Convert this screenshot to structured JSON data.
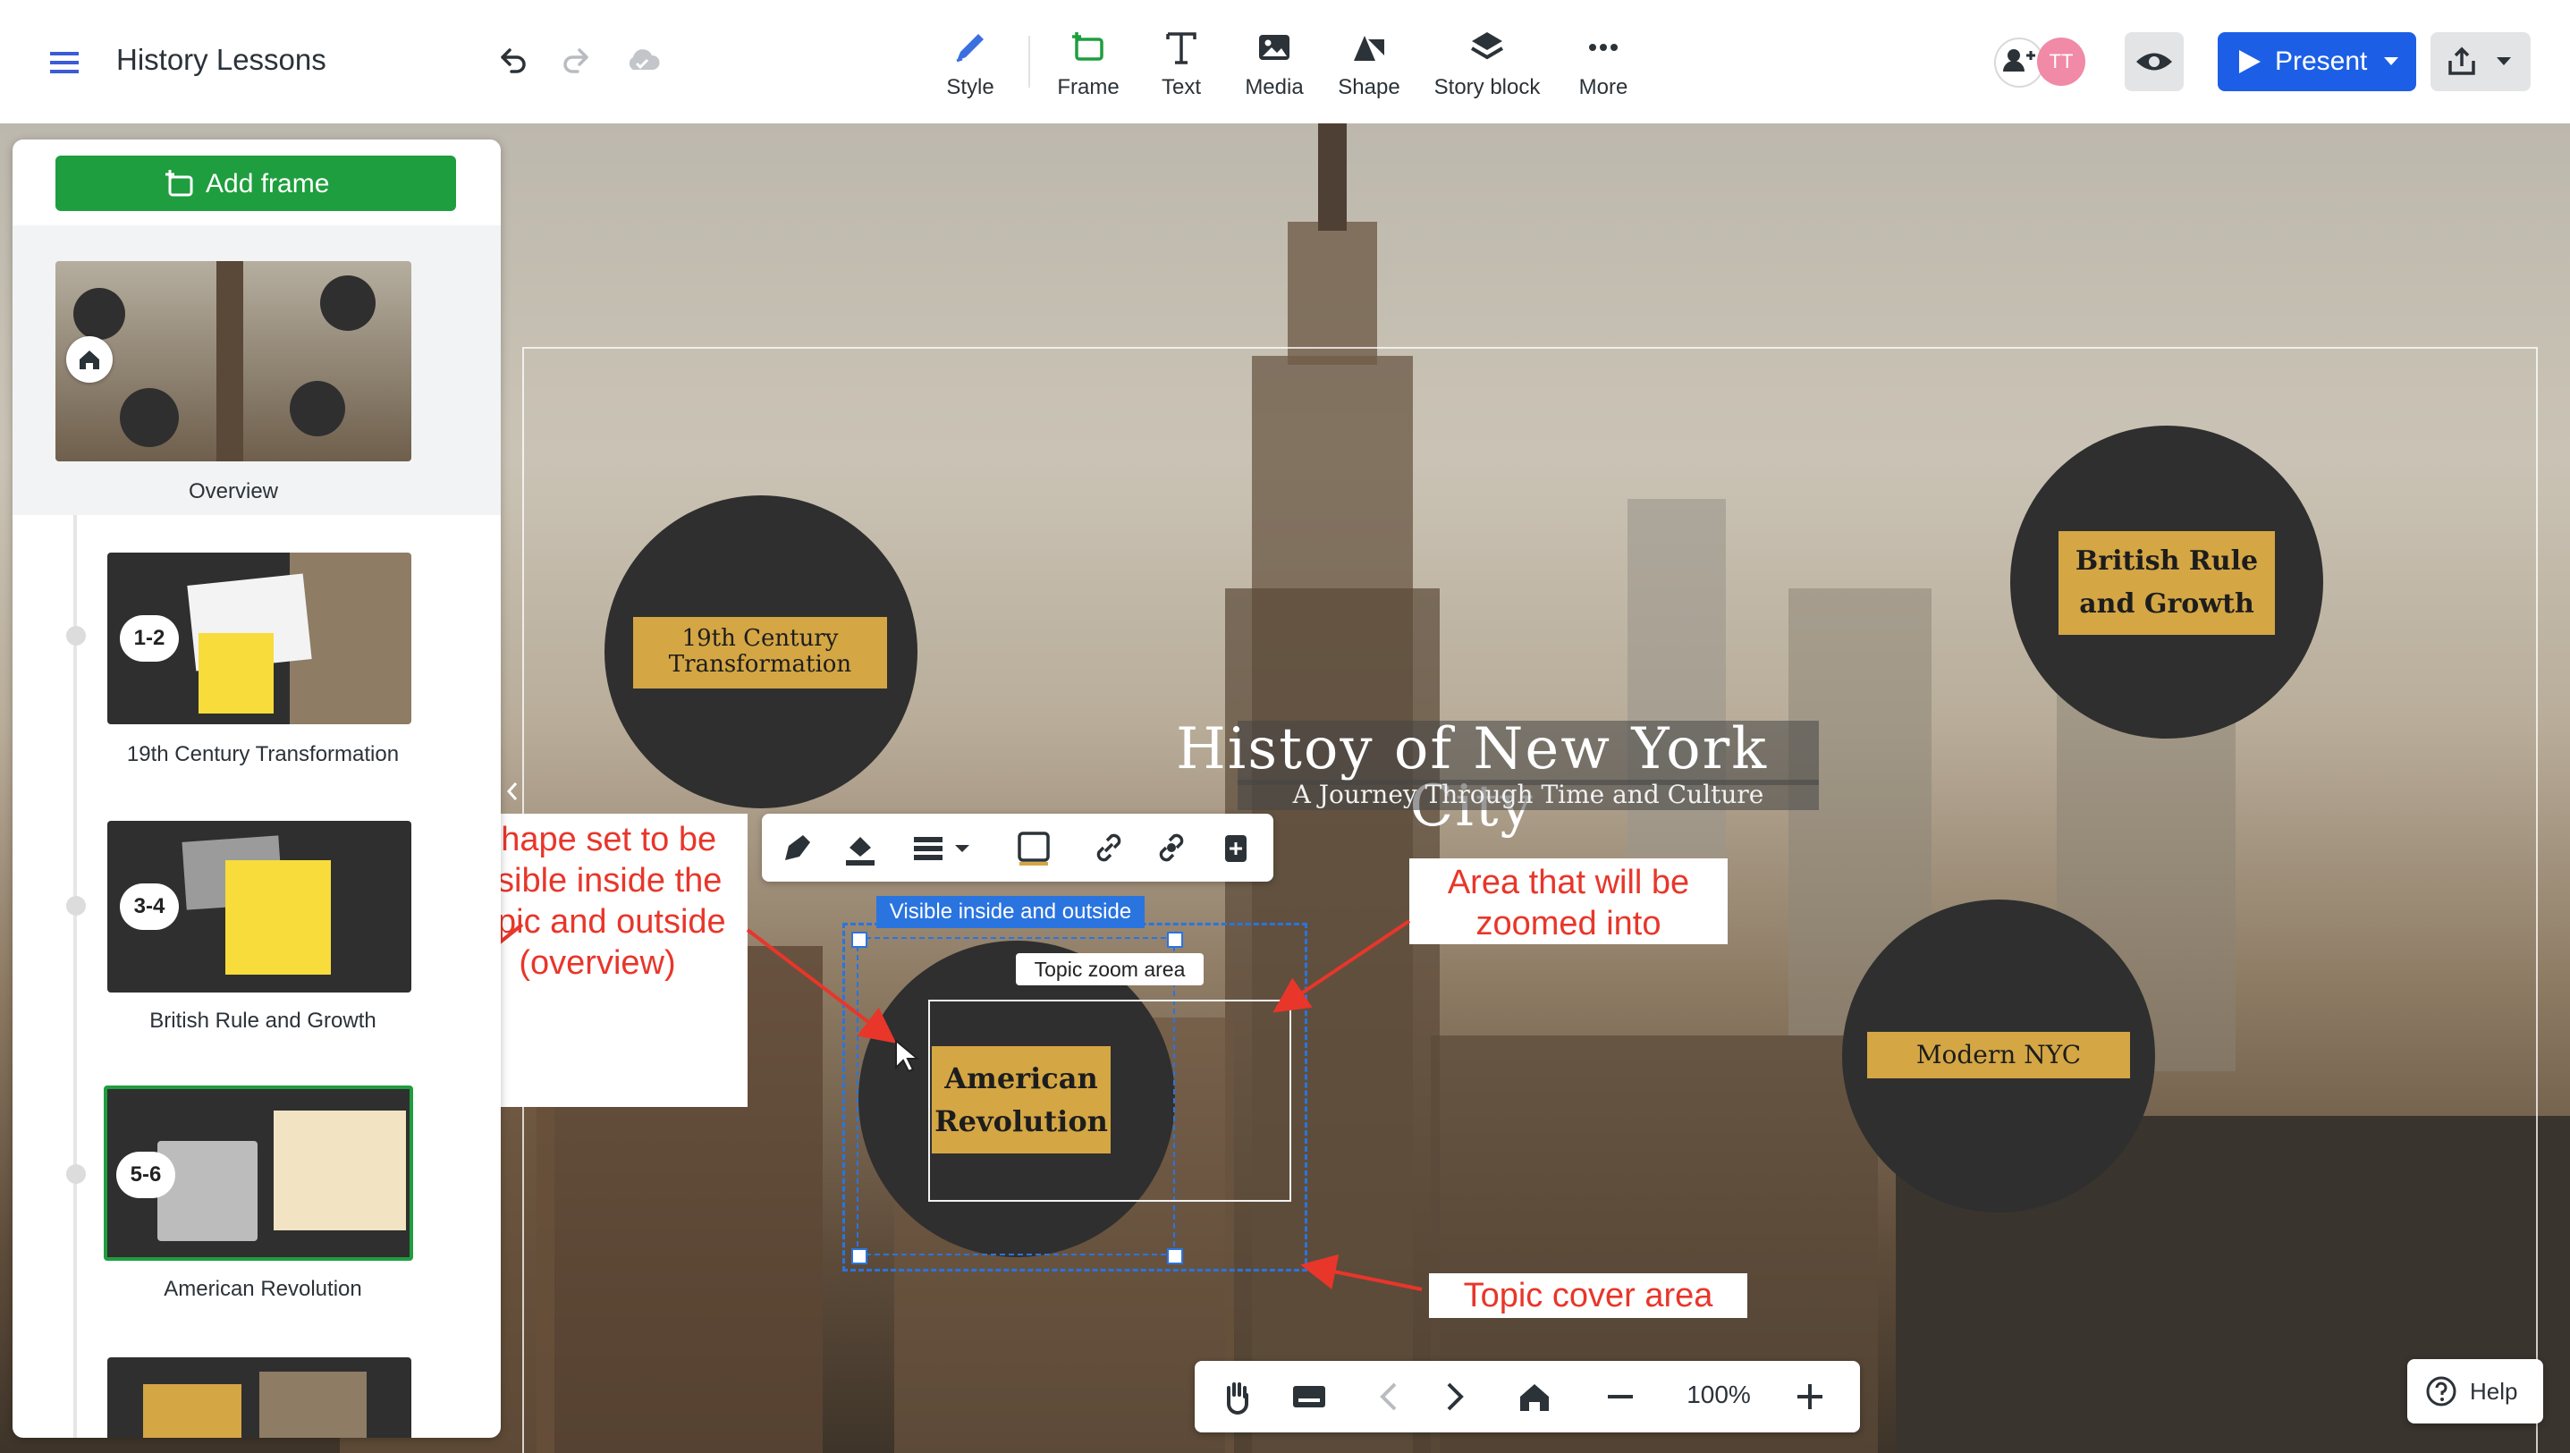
{
  "app": {
    "title": "History Lessons"
  },
  "toolbar": {
    "tools": [
      {
        "label": "Style",
        "icon": "pen-icon"
      },
      {
        "label": "Frame",
        "icon": "frame-icon"
      },
      {
        "label": "Text",
        "icon": "text-icon"
      },
      {
        "label": "Media",
        "icon": "image-icon"
      },
      {
        "label": "Shape",
        "icon": "shape-icon"
      },
      {
        "label": "Story block",
        "icon": "layers-icon"
      },
      {
        "label": "More",
        "icon": "more-dots-icon"
      }
    ],
    "avatar_initials": "TT",
    "present_label": "Present",
    "accent_color": "#1c5fe6"
  },
  "sidebar": {
    "add_frame_label": "Add frame",
    "overview_label": "Overview",
    "frames": [
      {
        "badge": "1-2",
        "label": "19th Century Transformation"
      },
      {
        "badge": "3-4",
        "label": "British Rule and Growth"
      },
      {
        "badge": "5-6",
        "label": "American Revolution"
      }
    ],
    "add_frame_color": "#1e9e3e"
  },
  "canvas": {
    "title": "Histoy of New York City",
    "subtitle": "A Journey Through Time and Culture",
    "topics": [
      {
        "label": "19th Century Transformation"
      },
      {
        "label": "British Rule and Growth"
      },
      {
        "label": "American Revolution"
      },
      {
        "label": "Modern NYC"
      }
    ],
    "visibility_tag": "Visible inside and outside",
    "zoom_area_tag": "Topic zoom area",
    "topic_label_color": "#d4a644"
  },
  "annotations": {
    "shape_visible": "Shape set to be visible inside the topic and outside (overview)",
    "zoom_area": "Area that will be zoomed into",
    "cover_area": "Topic cover area"
  },
  "bottom_bar": {
    "zoom": "100%"
  },
  "help": {
    "label": "Help"
  }
}
